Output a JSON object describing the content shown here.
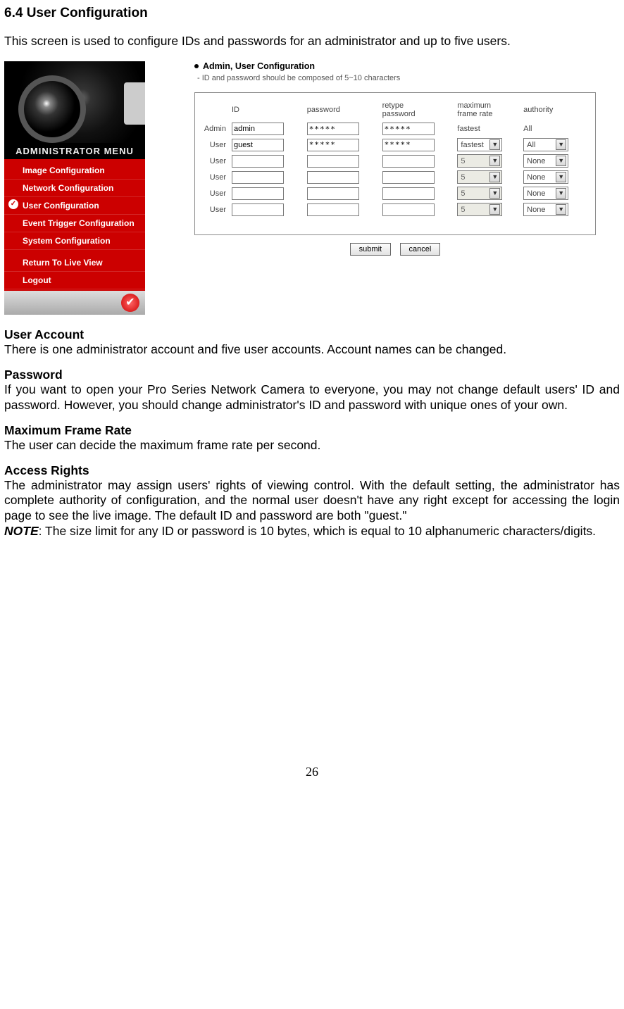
{
  "section": {
    "heading": "6.4 User Configuration",
    "intro": "This screen is used to configure IDs and passwords for an administrator and up to five users."
  },
  "menu": {
    "title": "ADMINISTRATOR MENU",
    "items": [
      {
        "label": "Image Configuration",
        "selected": false
      },
      {
        "label": "Network Configuration",
        "selected": false
      },
      {
        "label": "User Configuration",
        "selected": true
      },
      {
        "label": "Event Trigger Configuration",
        "selected": false
      },
      {
        "label": "System Configuration",
        "selected": false
      }
    ],
    "items2": [
      {
        "label": "Return To Live View"
      },
      {
        "label": "Logout"
      }
    ]
  },
  "panel": {
    "title": "Admin, User Configuration",
    "subtitle": "- ID and password should be composed of 5~10 characters",
    "headers": {
      "id": "ID",
      "password": "password",
      "retype": "retype password",
      "framerate": "maximum frame rate",
      "authority": "authority"
    },
    "rows": [
      {
        "label": "Admin",
        "id": "admin",
        "pw": "*****",
        "rpw": "*****",
        "rate": "fastest",
        "rate_enabled": false,
        "rate_text_only": true,
        "auth": "All",
        "auth_enabled": false,
        "auth_text_only": true
      },
      {
        "label": "User",
        "id": "guest",
        "pw": "*****",
        "rpw": "*****",
        "rate": "fastest",
        "rate_enabled": true,
        "auth": "All",
        "auth_enabled": true
      },
      {
        "label": "User",
        "id": "",
        "pw": "",
        "rpw": "",
        "rate": "5",
        "rate_enabled": false,
        "auth": "None",
        "auth_enabled": true
      },
      {
        "label": "User",
        "id": "",
        "pw": "",
        "rpw": "",
        "rate": "5",
        "rate_enabled": false,
        "auth": "None",
        "auth_enabled": true
      },
      {
        "label": "User",
        "id": "",
        "pw": "",
        "rpw": "",
        "rate": "5",
        "rate_enabled": false,
        "auth": "None",
        "auth_enabled": true
      },
      {
        "label": "User",
        "id": "",
        "pw": "",
        "rpw": "",
        "rate": "5",
        "rate_enabled": false,
        "auth": "None",
        "auth_enabled": true
      }
    ],
    "buttons": {
      "submit": "submit",
      "cancel": "cancel"
    }
  },
  "body": {
    "user_account_h": "User Account",
    "user_account_t": "There is one administrator account and five user accounts. Account names can be changed.",
    "password_h": "Password",
    "password_t": "If you want to open your Pro Series Network Camera to everyone, you may not change default users' ID and password. However, you should change administrator's ID and password with unique ones of your own.",
    "maxframe_h": "Maximum Frame Rate",
    "maxframe_t": "The user can decide the maximum frame rate per second.",
    "access_h": "Access Rights",
    "access_t": "The administrator may assign users' rights of viewing control. With the default setting, the administrator has complete authority of configuration, and the normal user doesn't have any right except for accessing the login page to see the live image. The default ID and password are both \"guest.\"",
    "note_label": "NOTE",
    "note_t": ": The size limit for any ID or password is 10 bytes, which is equal to 10 alphanumeric characters/digits."
  },
  "page_number": "26"
}
